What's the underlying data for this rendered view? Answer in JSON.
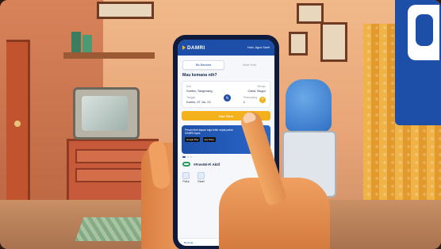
{
  "app": {
    "logo_text": "DAMRI",
    "greeting": "Halo, Agus Santi"
  },
  "tabs": [
    {
      "label": "Bis Bandara"
    },
    {
      "label": "Antar Kota"
    }
  ],
  "heading": "Mau kemana nih?",
  "form": {
    "from_label": "Dari",
    "from_value": "Soetta, Tangerang",
    "to_label": "Menuju",
    "to_value": "Ciawi, Bogor",
    "date_label": "Tanggal",
    "date_value": "Kamis, 07 Jul. 22",
    "passenger_label": "Penumpang",
    "passenger_value": "1"
  },
  "search_button": "Cari Tiket",
  "promo": {
    "text": "Pesan tiket kapan saja lebih cepat pakai DAMRI Apps",
    "store_1": "Google Play",
    "store_2": "App Store"
  },
  "wifi_banner": "#FreeWi-Fi Aktif",
  "menu": [
    {
      "label": "Pulsa"
    },
    {
      "label": "Paket"
    }
  ],
  "bottom_nav": {
    "home_label": "Beranda"
  },
  "colors": {
    "brand_blue": "#1d4fa8",
    "accent_yellow": "#f3b21b"
  }
}
